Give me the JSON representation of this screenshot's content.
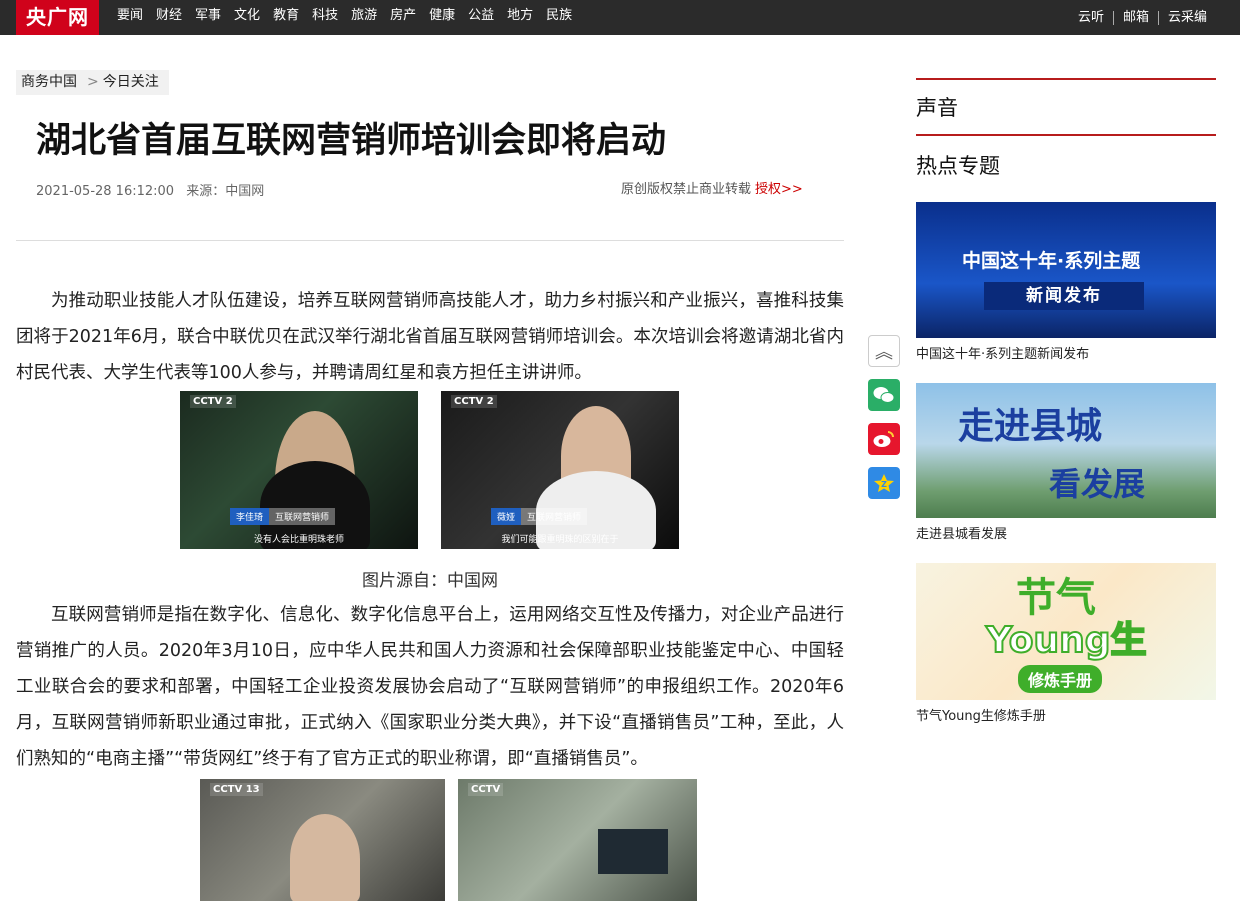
{
  "header": {
    "logo": "央广网",
    "nav": [
      "要闻",
      "财经",
      "军事",
      "文化",
      "教育",
      "科技",
      "旅游",
      "房产",
      "健康",
      "公益",
      "地方",
      "民族"
    ],
    "right_links": [
      "云听",
      "邮箱",
      "云采编"
    ]
  },
  "breadcrumb": {
    "section": "商务中国",
    "separator": ">",
    "current": "今日关注"
  },
  "article": {
    "title": "湖北省首届互联网营销师培训会即将启动",
    "date": "2021-05-28 16:12:00",
    "source": "来源：中国网",
    "copyright": "原创版权禁止商业转载",
    "authorize": "授权>>",
    "para1": "为推动职业技能人才队伍建设，培养互联网营销师高技能人才，助力乡村振兴和产业振兴，喜推科技集团将于2021年6月，联合中联优贝在武汉举行湖北省首届互联网营销师培训会。本次培训会将邀请湖北省内村民代表、大学生代表等100人参与，并聘请周红星和袁方担任主讲讲师。",
    "image_caption": "图片源自：中国网",
    "para2": "互联网营销师是指在数字化、信息化、数字化信息平台上，运用网络交互性及传播力，对企业产品进行营销推广的人员。2020年3月10日，应中华人民共和国人力资源和社会保障部职业技能鉴定中心、中国轻工业联合会的要求和部署，中国轻工企业投资发展协会启动了“互联网营销师”的申报组织工作。2020年6月，互联网营销师新职业通过审批，正式纳入《国家职业分类大典》，并下设“直播销售员”工种，至此，人们熟知的“电商主播”“带货网红”终于有了官方正式的职业称谓，即“直播销售员”。",
    "img1": {
      "logo": "CCTV 2",
      "name": "李佳琦",
      "role": "互联网营销师",
      "subtitle": "没有人会比重明珠老师"
    },
    "img2": {
      "logo": "CCTV 2",
      "name": "薇娅",
      "role": "互联网营销师",
      "subtitle": "我们可能跟重明珠的区别在于"
    },
    "img3": {
      "logo": "CCTV 13"
    },
    "img4": {
      "logo": "CCTV"
    }
  },
  "share": {
    "top_icon": "double-chevron-up-icon",
    "wechat_icon": "wechat-icon",
    "weibo_icon": "weibo-icon",
    "qzone_icon": "qzone-icon"
  },
  "sidebar": {
    "voice_heading": "声音",
    "topics_heading": "热点专题",
    "promos": [
      {
        "line1": "中国这十年·系列主题",
        "line2": "新闻发布",
        "caption": "中国这十年·系列主题新闻发布"
      },
      {
        "line1": "走进县城",
        "line2": "看发展",
        "caption": "走进县城看发展"
      },
      {
        "line1": "节气",
        "line2": "Young生",
        "line3": "修炼手册",
        "caption": "节气Young生修炼手册"
      }
    ]
  },
  "colors": {
    "accent": "#d0021b",
    "topbar": "#2b2b2b",
    "rule": "#b71c1c"
  }
}
